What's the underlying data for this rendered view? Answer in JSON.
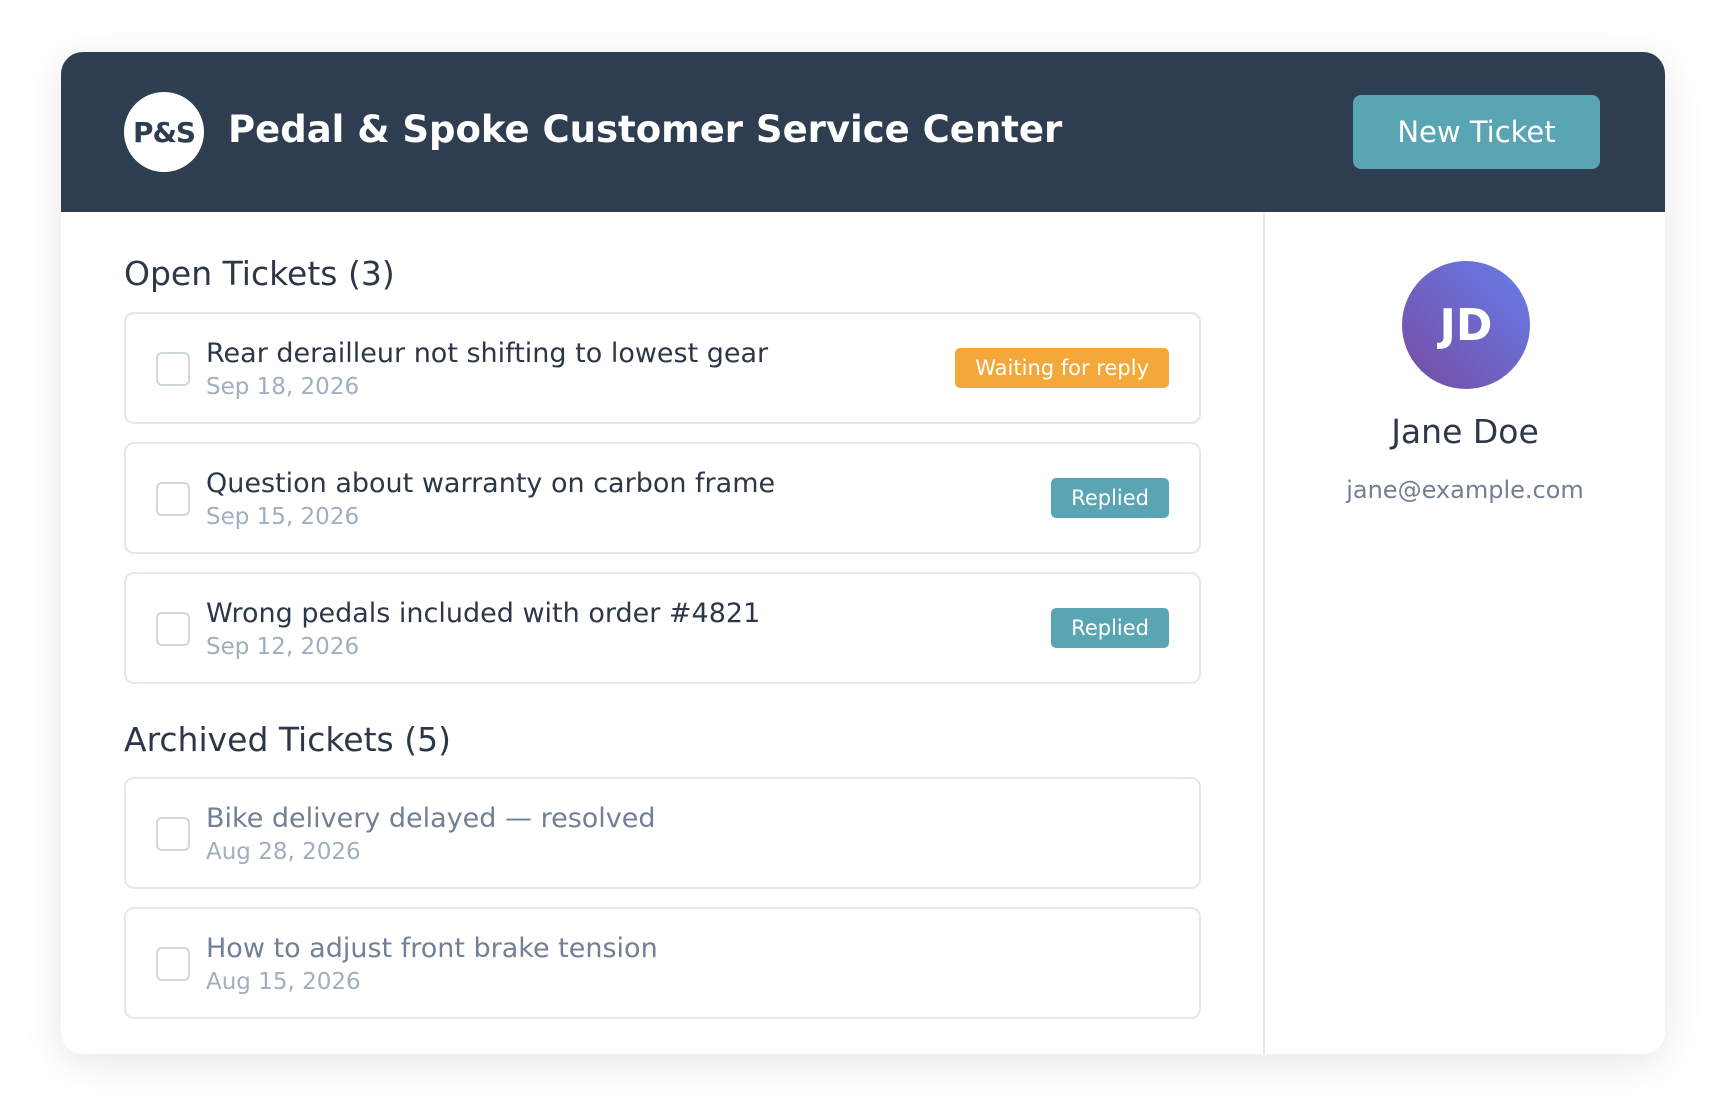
{
  "header": {
    "logo_text": "P&S",
    "title": "Pedal & Spoke Customer Service Center",
    "new_ticket_label": "New Ticket"
  },
  "open_section": {
    "title": "Open Tickets (3)",
    "tickets": [
      {
        "title": "Rear derailleur not shifting to lowest gear",
        "date": "Sep 18, 2026",
        "status": "Waiting for reply"
      },
      {
        "title": "Question about warranty on carbon frame",
        "date": "Sep 15, 2026",
        "status": "Replied"
      },
      {
        "title": "Wrong pedals included with order #4821",
        "date": "Sep 12, 2026",
        "status": "Replied"
      }
    ]
  },
  "archived_section": {
    "title": "Archived Tickets (5)",
    "tickets": [
      {
        "title": "Bike delivery delayed — resolved",
        "date": "Aug 28, 2026"
      },
      {
        "title": "How to adjust front brake tension",
        "date": "Aug 15, 2026"
      }
    ]
  },
  "user": {
    "initials": "JD",
    "name": "Jane Doe",
    "email": "jane@example.com"
  },
  "colors": {
    "header_bg": "#2e3e50",
    "accent": "#5aa5b4",
    "waiting": "#f4a83a",
    "avatar_gradient_start": "#764ba2",
    "avatar_gradient_end": "#667eea"
  },
  "icons": {
    "checkbox": "checkbox-icon"
  }
}
